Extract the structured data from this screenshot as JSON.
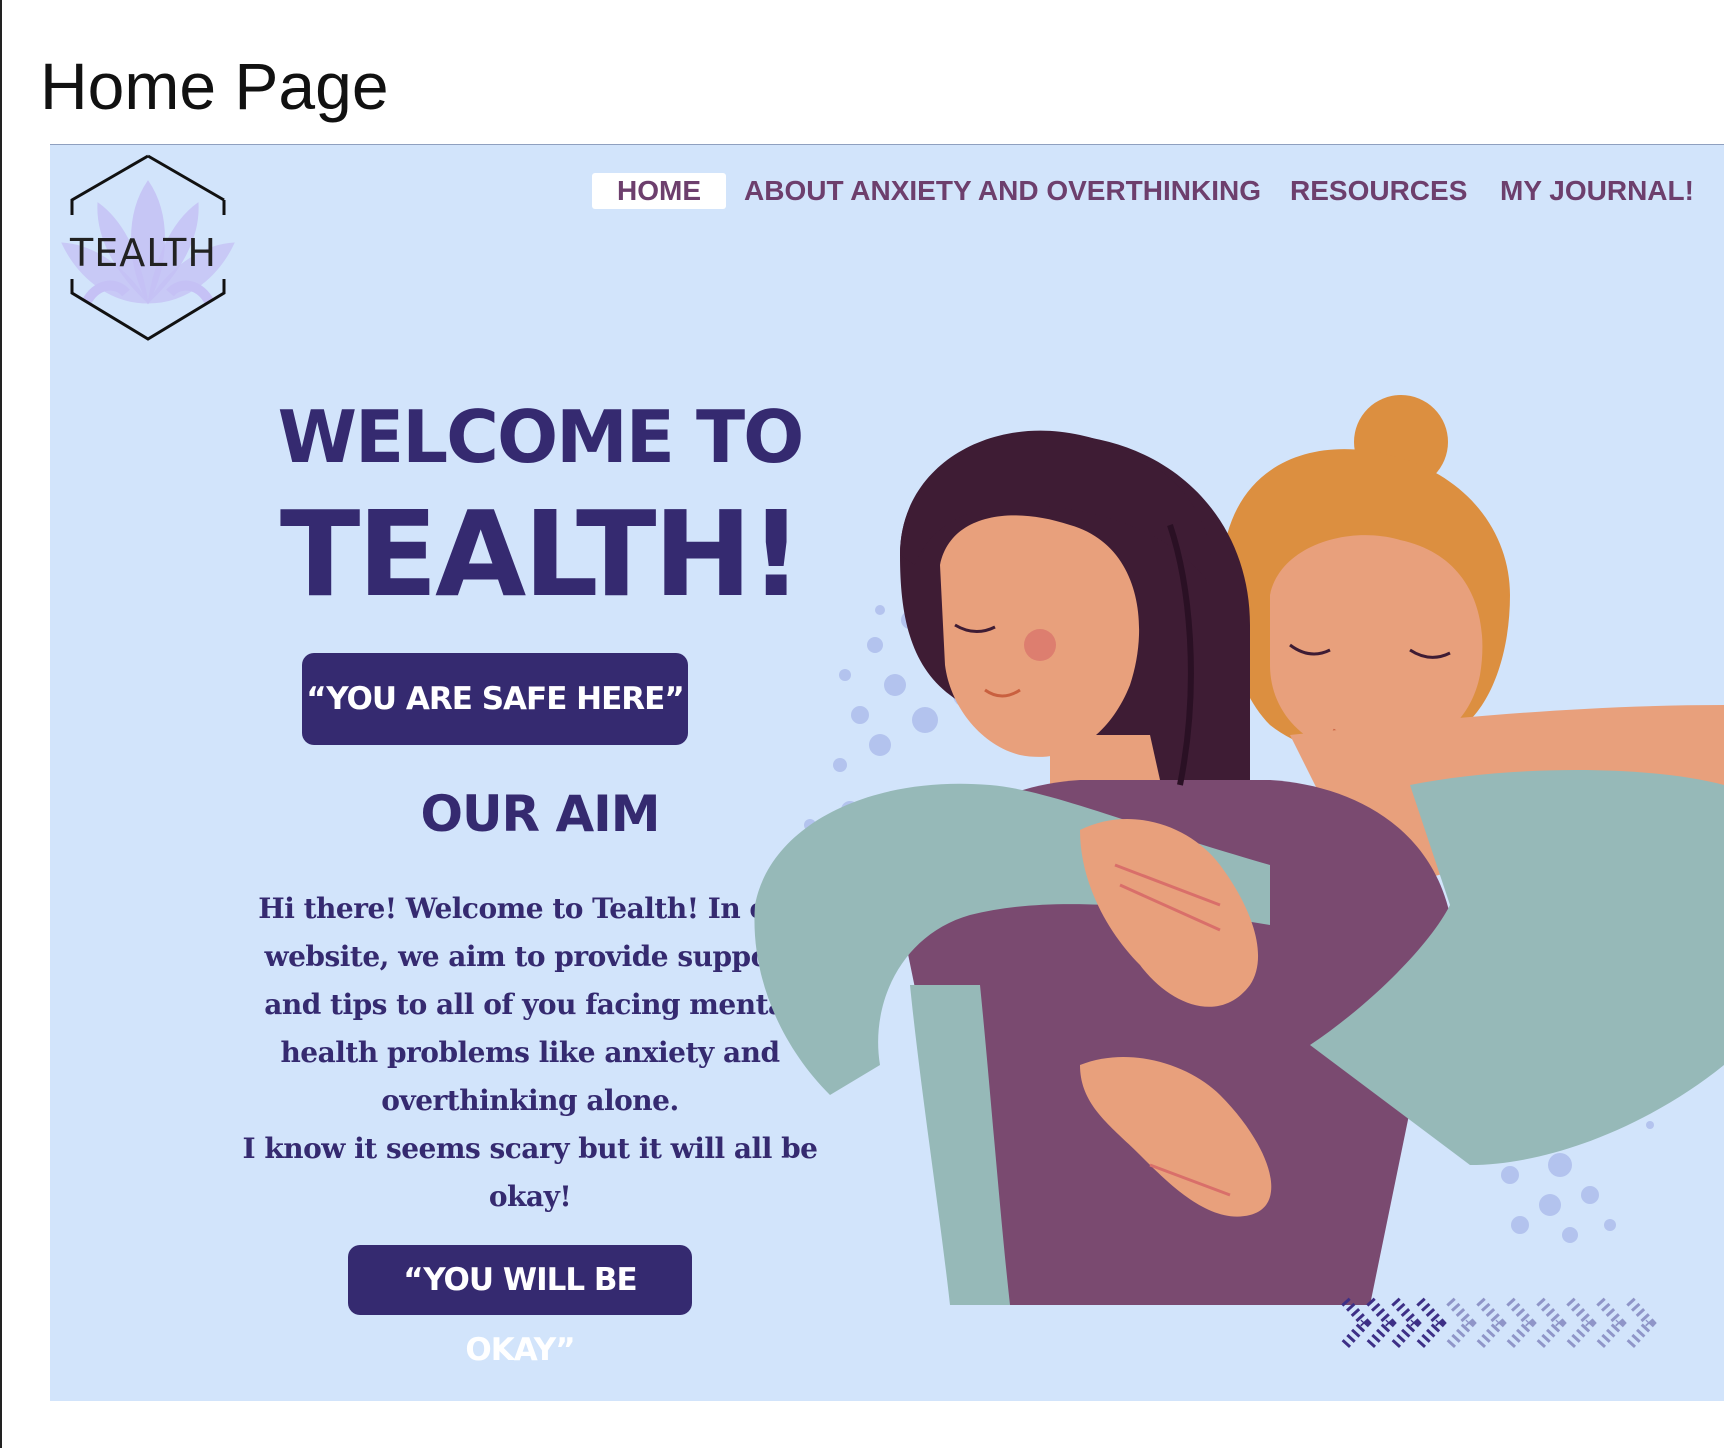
{
  "document": {
    "title": "Home Page"
  },
  "logo": {
    "text": "TEALTH"
  },
  "nav": {
    "items": [
      {
        "label": "HOME",
        "active": true
      },
      {
        "label": "ABOUT ANXIETY AND OVERTHINKING",
        "active": false
      },
      {
        "label": "RESOURCES",
        "active": false
      },
      {
        "label": "MY JOURNAL!",
        "active": false
      }
    ]
  },
  "hero": {
    "welcome": "WELCOME TO",
    "brand": "TEALTH!",
    "safe_button": "“YOU ARE SAFE HERE”",
    "aim_heading": "OUR AIM",
    "aim_text": "Hi there! Welcome to Tealth!  In our website,  we aim to provide support and tips to all of you facing mental health problems like anxiety and overthinking alone.\nI know it seems scary but it will all be okay!",
    "okay_button": "“YOU WILL BE OKAY”"
  },
  "colors": {
    "background": "#d2e4fb",
    "primary": "#352a70",
    "nav_text": "#6d3f6d",
    "shirt": "#7a4a70",
    "sleeve": "#96b9b8",
    "skin": "#e8a07c",
    "hair_dark": "#3e1c34",
    "hair_light": "#dc8f40",
    "logo_lotus": "#c5c1f5"
  },
  "icons": [
    "hexagon-lotus-logo",
    "chevron-arrows-decoration"
  ]
}
